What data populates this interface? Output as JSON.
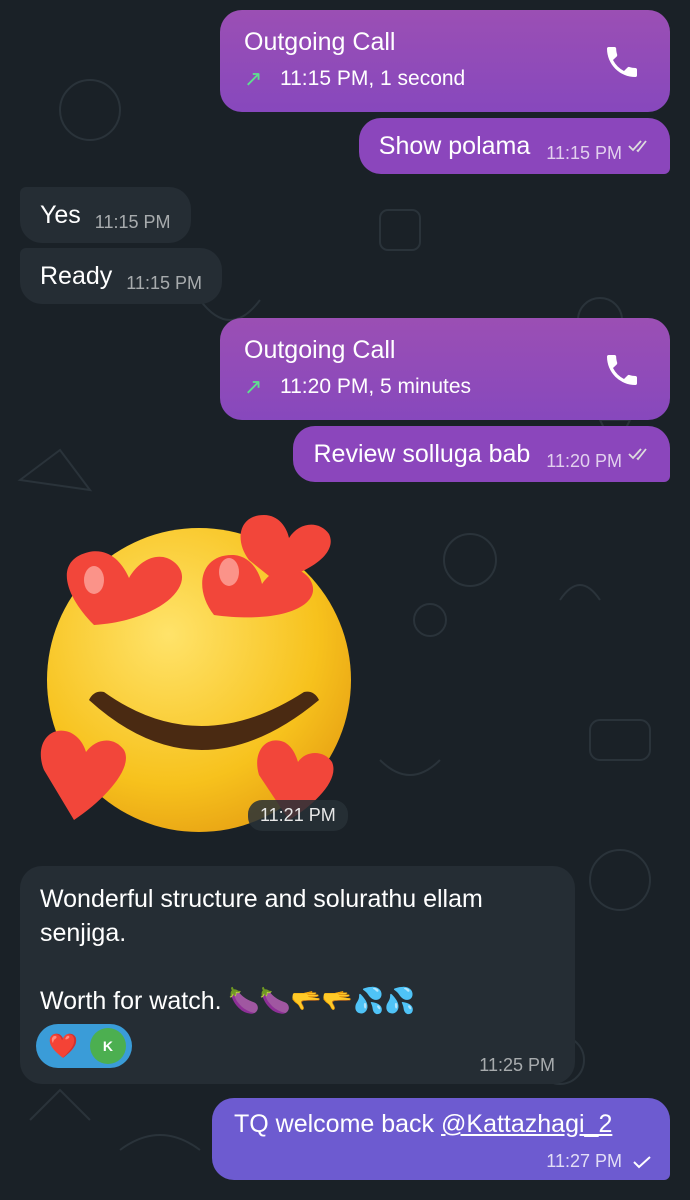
{
  "messages": {
    "call1": {
      "title": "Outgoing Call",
      "detail": "11:15 PM, 1 second"
    },
    "out1": {
      "text": "Show polama",
      "time": "11:15 PM"
    },
    "in1": {
      "text": "Yes",
      "time": "11:15 PM"
    },
    "in2": {
      "text": "Ready",
      "time": "11:15 PM"
    },
    "call2": {
      "title": "Outgoing Call",
      "detail": "11:20 PM, 5 minutes"
    },
    "out2": {
      "text": "Review solluga bab",
      "time": "11:20 PM"
    },
    "sticker": {
      "time": "11:21 PM"
    },
    "long": {
      "line1": "Wonderful structure and  solurathu ellam",
      "line2": "senjiga.",
      "line3": "Worth for watch. 🍆🍆🫳🫳💦💦",
      "reaction": "❤️",
      "reactor_initial": "K",
      "time": "11:25 PM"
    },
    "last": {
      "text": "TQ welcome back ",
      "mention": "@Kattazhagi_2",
      "time": "11:27 PM"
    }
  },
  "icons": {
    "call_arrow": "arrow-up-right-icon",
    "phone": "phone-icon",
    "read": "double-check-icon",
    "sent": "check-icon"
  },
  "colors": {
    "background": "#1a2127",
    "outgoing": "#8b46bc",
    "incoming": "#252d34",
    "reaction": "#3a9cd8",
    "last_outgoing": "#6d5bd0"
  }
}
